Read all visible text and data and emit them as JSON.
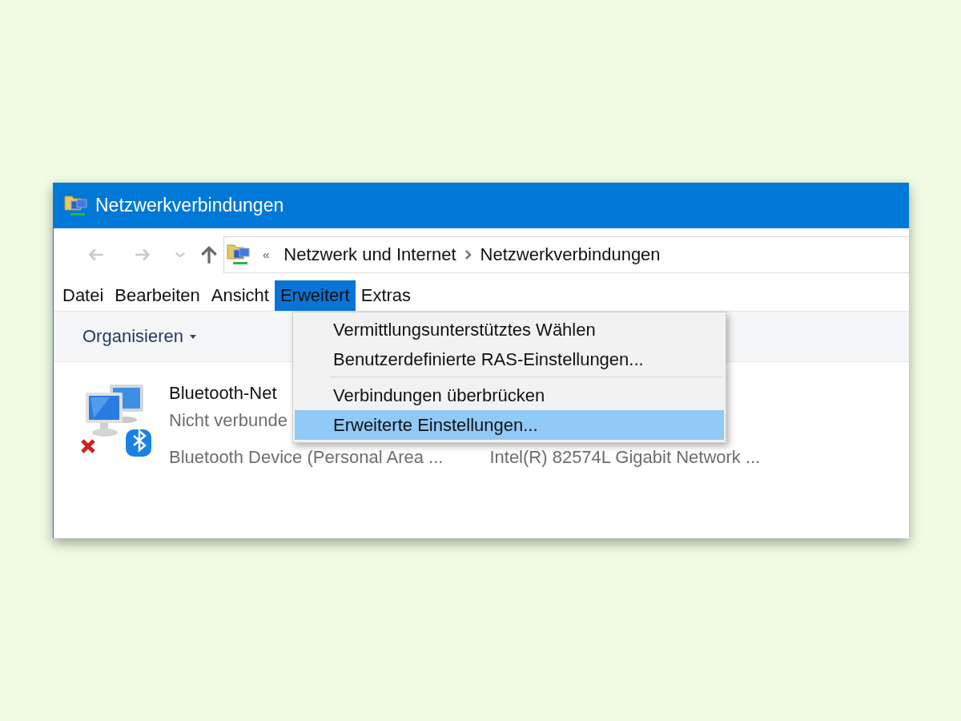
{
  "window": {
    "title": "Netzwerkverbindungen"
  },
  "nav_buttons": [
    {
      "kind": "back",
      "disabled": true
    },
    {
      "kind": "forward",
      "disabled": true
    },
    {
      "kind": "recent",
      "disabled": true
    },
    {
      "kind": "up",
      "disabled": false
    }
  ],
  "address_bar": {
    "overflow": "«",
    "segments": [
      "Netzwerk und Internet",
      "Netzwerkverbindungen"
    ]
  },
  "menu_bar": [
    {
      "label": "Datei",
      "selected": false
    },
    {
      "label": "Bearbeiten",
      "selected": false
    },
    {
      "label": "Ansicht",
      "selected": false
    },
    {
      "label": "Erweitert",
      "selected": true
    },
    {
      "label": "Extras",
      "selected": false
    }
  ],
  "command_bar": {
    "organize": "Organisieren"
  },
  "dropdown_menu": [
    {
      "label": "Vermittlungsunterstütztes Wählen",
      "selected": false,
      "separator_before": false
    },
    {
      "label": "Benutzerdefinierte RAS-Einstellungen...",
      "selected": false,
      "separator_before": false
    },
    {
      "label": "Verbindungen überbrücken",
      "selected": false,
      "separator_before": true
    },
    {
      "label": "Erweiterte Einstellungen...",
      "selected": true,
      "separator_before": false
    }
  ],
  "connections": [
    {
      "name": "Bluetooth-Net",
      "status": "Nicht verbunde",
      "device": "Bluetooth Device (Personal Area ...",
      "disconnected": true
    },
    {
      "device": "Intel(R) 82574L Gigabit Network ..."
    }
  ]
}
